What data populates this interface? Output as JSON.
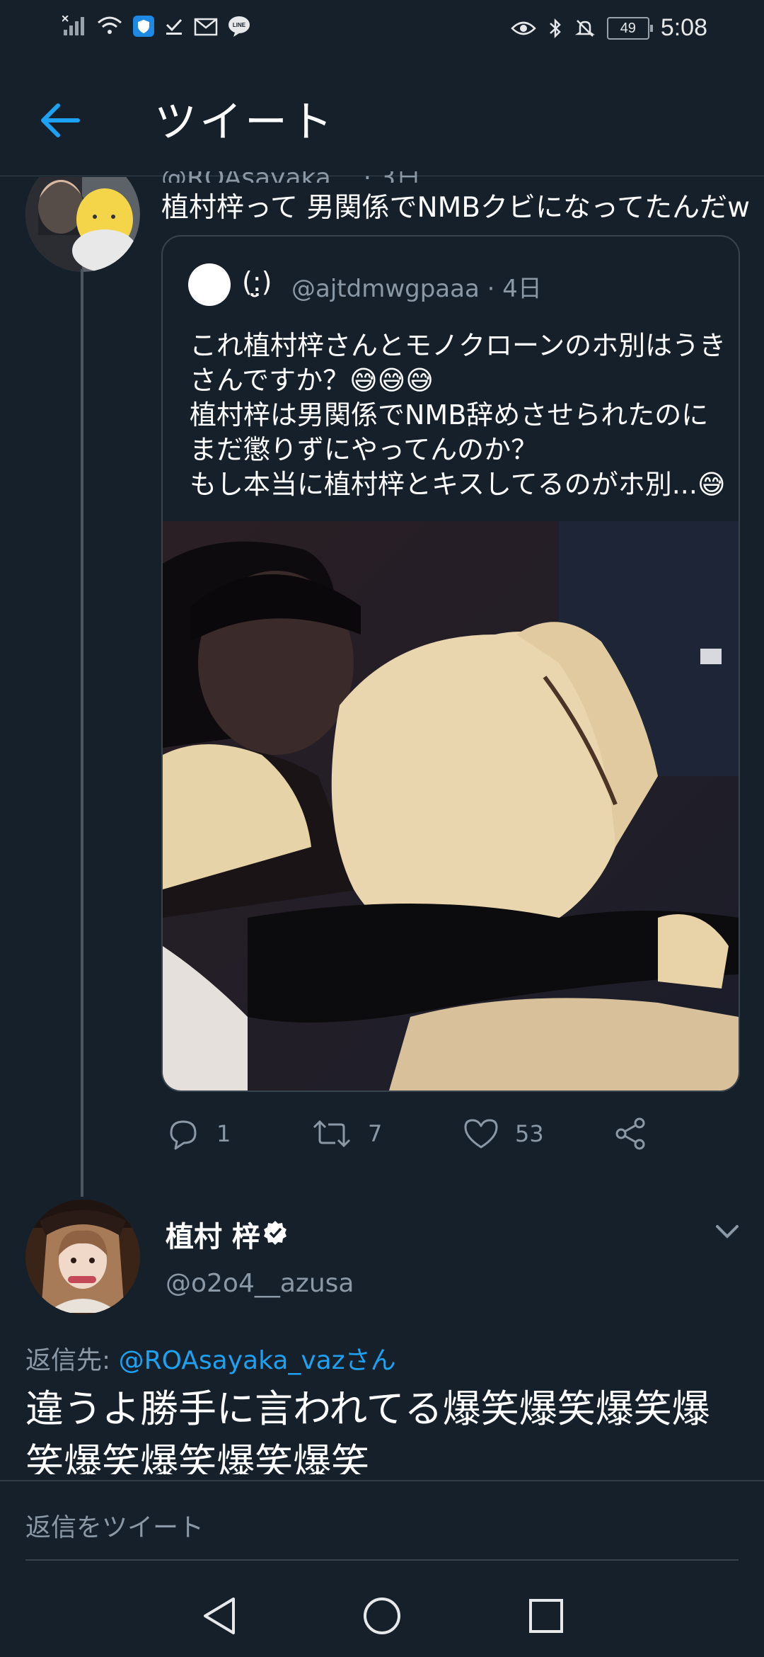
{
  "status_bar": {
    "time": "5:08",
    "battery": "49",
    "left_icons": [
      "signal-icon",
      "wifi-icon",
      "shield-app-icon",
      "check-icon",
      "mail-icon",
      "line-app-icon"
    ],
    "right_icons": [
      "eye-icon",
      "bluetooth-icon",
      "mute-icon",
      "battery-icon"
    ]
  },
  "header": {
    "title": "ツイート"
  },
  "previous_tweet": {
    "header_partial": "@ROAsayaka... · 3日",
    "text": "植村梓って 男関係でNMBクビになってたんだw",
    "quote": {
      "name": "(:̤̮)",
      "handle": "@ajtdmwgpaaa · 4日",
      "text": "これ植村梓さんとモノクローンのホ別はうきさんですか？😅😅😅\n植村梓は男関係でNMB辞めさせられたのにまだ懲りずにやってんのか？\nもし本当に植村梓とキスしてるのがホ別...😅"
    },
    "actions": {
      "reply_count": "1",
      "retweet_count": "7",
      "like_count": "53"
    }
  },
  "main_tweet": {
    "name": "植村 梓",
    "handle": "@o2o4__azusa",
    "reply_to_label": "返信先: ",
    "reply_to_mention": "@ROAsayaka_vazさん",
    "text": "違うよ勝手に言われてる爆笑爆笑爆笑爆笑爆笑爆笑爆笑爆笑"
  },
  "composer": {
    "placeholder": "返信をツイート"
  },
  "colors": {
    "background": "#15202b",
    "accent": "#1da1f2",
    "muted": "#8b98a5",
    "border": "#38444d"
  }
}
